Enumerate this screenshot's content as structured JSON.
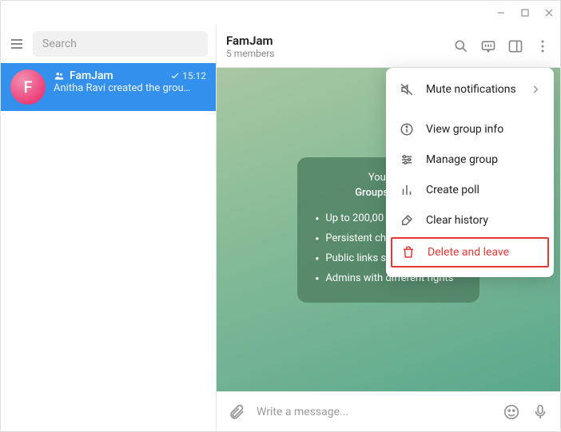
{
  "titlebar": {
    "minimize": "–",
    "maximize": "□",
    "close": "×"
  },
  "sidebar": {
    "search_placeholder": "Search",
    "chats": [
      {
        "avatar_letter": "F",
        "name": "FamJam",
        "time": "15:12",
        "preview": "Anitha Ravi created the grou…"
      }
    ]
  },
  "chat": {
    "title": "FamJam",
    "subtitle": "5 members",
    "info_card": {
      "line1": "You crea",
      "line2": "Groups can ha",
      "bullets": [
        "Up to 200,00",
        "Persistent chat history",
        "Public links such as t.me/title",
        "Admins with different rights"
      ]
    }
  },
  "composer": {
    "placeholder": "Write a message..."
  },
  "menu": {
    "mute": "Mute notifications",
    "view_info": "View group info",
    "manage": "Manage group",
    "poll": "Create poll",
    "clear": "Clear history",
    "delete": "Delete and leave"
  }
}
